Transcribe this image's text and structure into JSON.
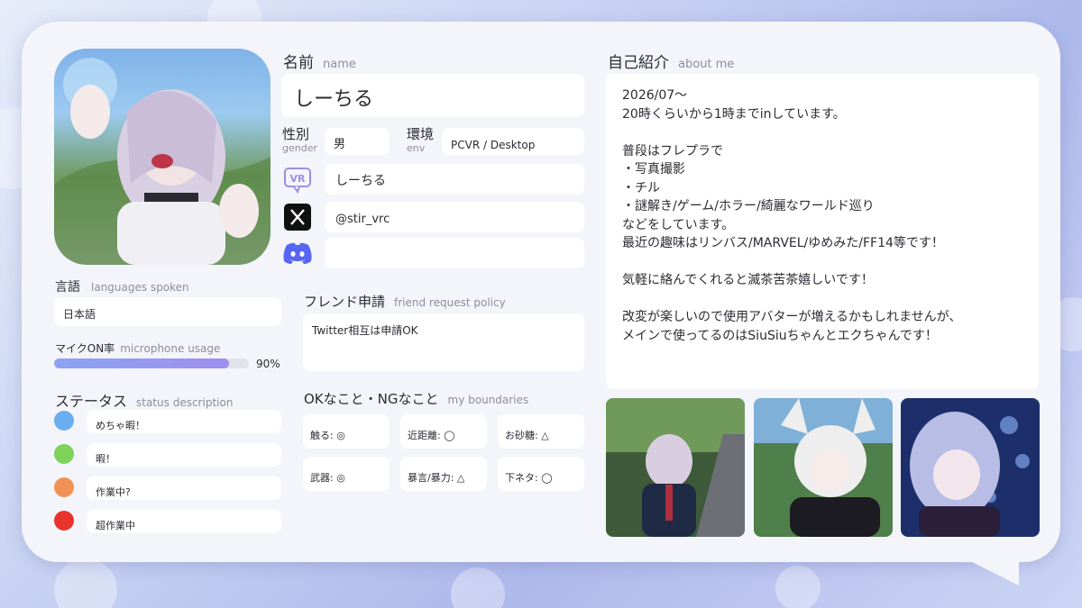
{
  "profile": {
    "name_label": "名前",
    "name_sub": "name",
    "name_value": "しーちる",
    "gender_label": "性別",
    "gender_sub": "gender",
    "gender_value": "男",
    "env_label": "環境",
    "env_sub": "env",
    "env_value": "PCVR / Desktop",
    "vrchat_name": "しーちる",
    "twitter_handle": "@stir_vrc",
    "discord_value": ""
  },
  "languages": {
    "label": "言語",
    "sub": "languages spoken",
    "value": "日本語"
  },
  "mic": {
    "label": "マイクON率",
    "sub": "microphone usage",
    "percent_text": "90%",
    "fraction": 0.9
  },
  "status": {
    "label": "ステータス",
    "sub": "status description",
    "items": [
      {
        "text": "めちゃ暇！",
        "color": "#6aaef0"
      },
      {
        "text": "暇！",
        "color": "#7fd25a"
      },
      {
        "text": "作業中?",
        "color": "#f09256"
      },
      {
        "text": "超作業中",
        "color": "#e8342c"
      }
    ]
  },
  "friend": {
    "label": "フレンド申請",
    "sub": "friend request policy",
    "value": "Twitter相互は申請OK"
  },
  "boundaries": {
    "label": "OKなこと・NGなこと",
    "sub": "my boundaries",
    "items": [
      "触る: ◎",
      "近距離: ◯",
      "お砂糖: △",
      "武器: ◎",
      "暴言/暴力: △",
      "下ネタ: ◯"
    ]
  },
  "about": {
    "label": "自己紹介",
    "sub": "about me",
    "lines": [
      "2026/07〜",
      "20時くらいから1時までinしています。",
      "",
      "普段はフレプラで",
      "・写真撮影",
      "・チル",
      "・謎解き/ゲーム/ホラー/綺麗なワールド巡り",
      "などをしています。",
      "最近の趣味はリンバス/MARVEL/ゆめみた/FF14等です！",
      "",
      "気軽に絡んでくれると滅茶苦茶嬉しいです！",
      "",
      "改変が楽しいので使用アバターが増えるかもしれませんが、",
      "メインで使ってるのはSiuSiuちゃんとエクちゃんです！"
    ]
  },
  "icons": {
    "vrchat": "vrchat-icon",
    "twitter": "x-twitter-icon",
    "discord": "discord-icon"
  },
  "colors": {
    "accent": "#8e97ee",
    "card_bg": "#f4f5fa",
    "panel_bg": "#ffffff"
  }
}
